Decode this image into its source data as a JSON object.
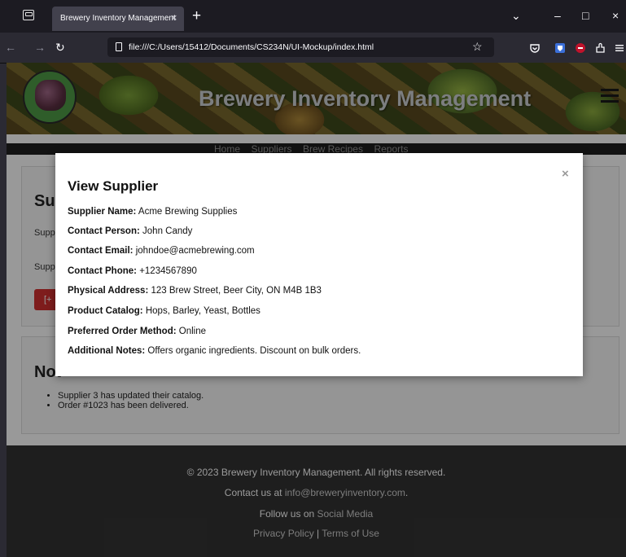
{
  "browser": {
    "tab_title": "Brewery Inventory Management",
    "tab_close": "×",
    "new_tab": "+",
    "url": "file:///C:/Users/15412/Documents/CS234N/UI-Mockup/index.html",
    "window_controls": {
      "list": "⌄",
      "minimize": "–",
      "maximize": "□",
      "close": "×"
    },
    "nav": {
      "back": "←",
      "forward": "→",
      "reload": "↻"
    },
    "bookmark_star": "☆"
  },
  "header": {
    "title": "Brewery Inventory Management",
    "menu_icon": "hamburger-icon"
  },
  "nav": {
    "items": [
      {
        "label": "Home"
      },
      {
        "label": "Suppliers"
      },
      {
        "label": "Brew Recipes"
      },
      {
        "label": "Reports"
      }
    ]
  },
  "suppliers_card": {
    "heading_partial": "Sup",
    "line1_partial": "Supp",
    "line2_partial": "Supp",
    "button_partial": "[+"
  },
  "notifications_card": {
    "heading_partial": "Not",
    "items": [
      "Supplier 3 has updated their catalog.",
      "Order #1023 has been delivered."
    ]
  },
  "footer": {
    "copyright": "© 2023 Brewery Inventory Management. All rights reserved.",
    "contact_prefix": "Contact us at ",
    "contact_email": "info@breweryinventory.com",
    "contact_suffix": ".",
    "follow_prefix": "Follow us on ",
    "follow_link": "Social Media",
    "privacy": "Privacy Policy",
    "separator": " | ",
    "terms": "Terms of Use"
  },
  "modal": {
    "title": "View Supplier",
    "close": "×",
    "fields": [
      {
        "label": "Supplier Name:",
        "value": "Acme Brewing Supplies"
      },
      {
        "label": "Contact Person:",
        "value": "John Candy"
      },
      {
        "label": "Contact Email:",
        "value": "johndoe@acmebrewing.com"
      },
      {
        "label": "Contact Phone:",
        "value": "+1234567890"
      },
      {
        "label": "Physical Address:",
        "value": "123 Brew Street, Beer City, ON M4B 1B3"
      },
      {
        "label": "Product Catalog:",
        "value": "Hops, Barley, Yeast, Bottles"
      },
      {
        "label": "Preferred Order Method:",
        "value": "Online"
      },
      {
        "label": "Additional Notes:",
        "value": "Offers organic ingredients. Discount on bulk orders."
      }
    ]
  },
  "colors": {
    "accent_red": "#d32f2f",
    "footer_bg": "#333333",
    "browser_bg": "#2b2a33"
  }
}
